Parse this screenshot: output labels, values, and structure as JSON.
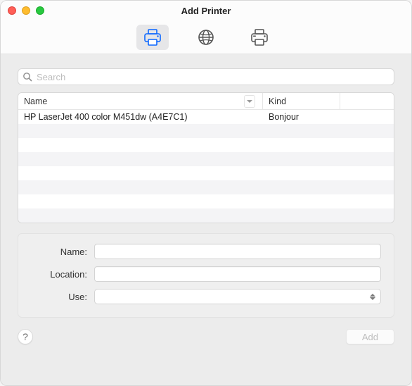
{
  "window": {
    "title": "Add Printer"
  },
  "toolbar": {
    "tabs": [
      {
        "id": "default",
        "selected": true
      },
      {
        "id": "ip",
        "selected": false
      },
      {
        "id": "windows",
        "selected": false
      }
    ]
  },
  "search": {
    "placeholder": "Search",
    "value": ""
  },
  "table": {
    "columns": {
      "name": "Name",
      "kind": "Kind"
    },
    "rows": [
      {
        "name": "HP LaserJet 400 color M451dw (A4E7C1)",
        "kind": "Bonjour"
      },
      {
        "name": "",
        "kind": ""
      },
      {
        "name": "",
        "kind": ""
      },
      {
        "name": "",
        "kind": ""
      },
      {
        "name": "",
        "kind": ""
      },
      {
        "name": "",
        "kind": ""
      },
      {
        "name": "",
        "kind": ""
      },
      {
        "name": "",
        "kind": ""
      }
    ]
  },
  "form": {
    "labels": {
      "name": "Name:",
      "location": "Location:",
      "use": "Use:"
    },
    "values": {
      "name": "",
      "location": "",
      "use": ""
    }
  },
  "footer": {
    "help": "?",
    "add": "Add",
    "add_enabled": false
  }
}
